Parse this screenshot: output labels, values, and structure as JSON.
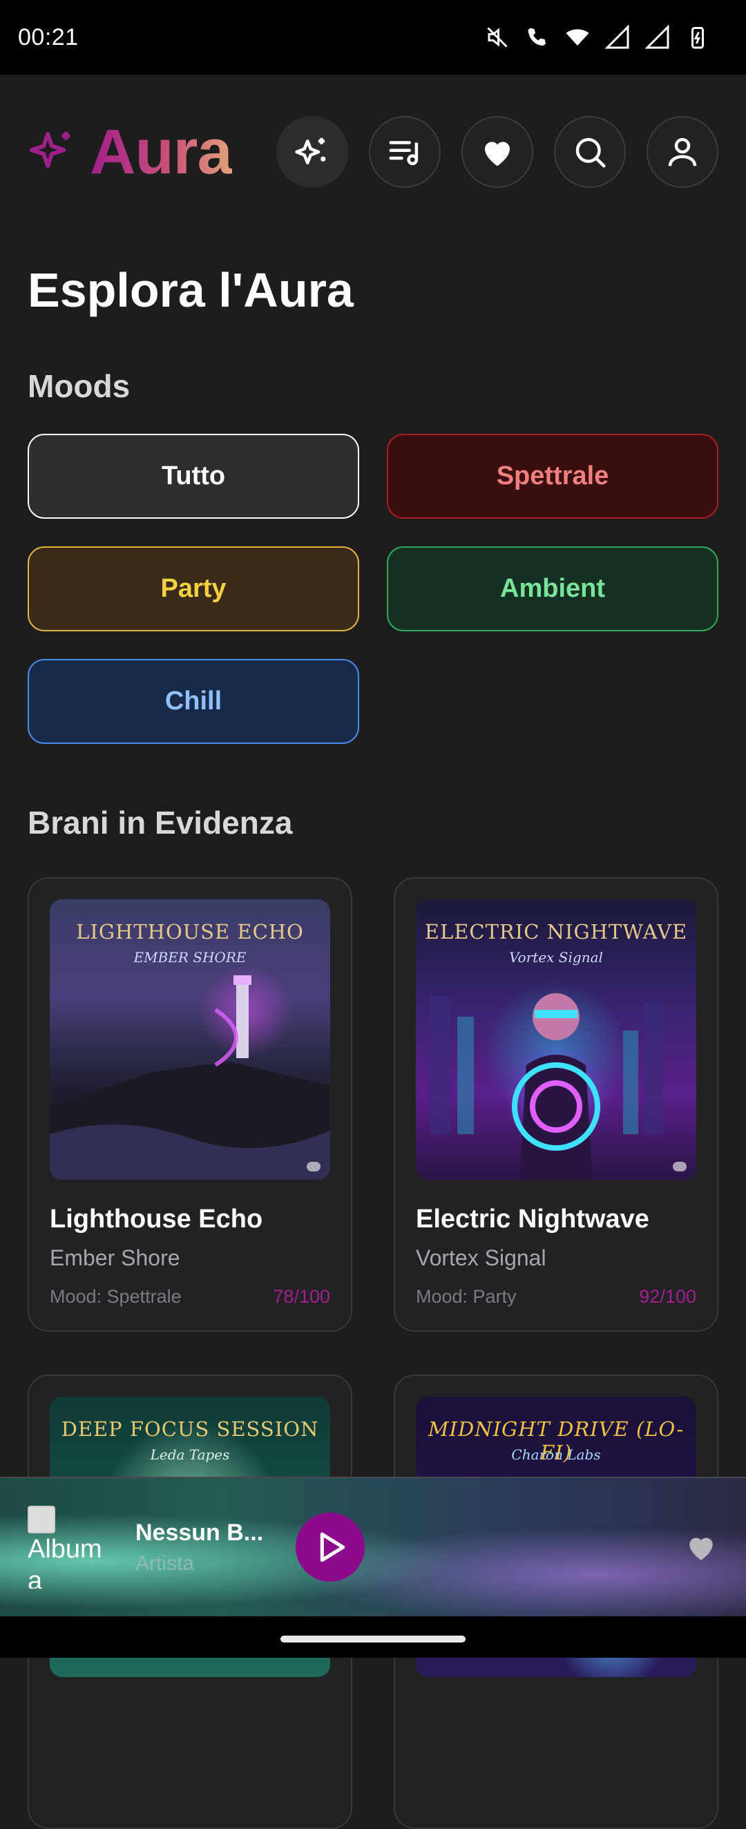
{
  "status_bar": {
    "time": "00:21"
  },
  "app": {
    "name": "Aura"
  },
  "header": {
    "buttons": [
      "sparkles-icon",
      "playlist-icon",
      "heart-icon",
      "search-icon",
      "user-icon"
    ]
  },
  "page": {
    "title": "Esplora l'Aura"
  },
  "moods": {
    "section_title": "Moods",
    "items": [
      {
        "label": "Tutto",
        "color": "#ffffff"
      },
      {
        "label": "Spettrale",
        "color": "#f08080"
      },
      {
        "label": "Party",
        "color": "#f5d040"
      },
      {
        "label": "Ambient",
        "color": "#79e39a"
      },
      {
        "label": "Chill",
        "color": "#8fc0ff"
      }
    ]
  },
  "featured": {
    "section_title": "Brani in Evidenza",
    "tracks": [
      {
        "cover_title": "LIGHTHOUSE ECHO",
        "cover_subtitle": "EMBER SHORE",
        "title": "Lighthouse Echo",
        "artist": "Ember Shore",
        "mood": "Mood: Spettrale",
        "score": "78/100"
      },
      {
        "cover_title": "ELECTRIC NIGHTWAVE",
        "cover_subtitle": "Vortex Signal",
        "title": "Electric Nightwave",
        "artist": "Vortex Signal",
        "mood": "Mood: Party",
        "score": "92/100"
      },
      {
        "cover_title": "DEEP FOCUS SESSION",
        "cover_subtitle": "Leda Tapes"
      },
      {
        "cover_title": "MIDNIGHT DRIVE (LO-FI)",
        "cover_subtitle": "Charon Labs"
      }
    ]
  },
  "player": {
    "art_alt": "Album a",
    "title": "Nessun B...",
    "artist": "Artista"
  },
  "colors": {
    "accent": "#8d0a8d",
    "score": "#a41e90",
    "background": "#1d1d1e"
  }
}
